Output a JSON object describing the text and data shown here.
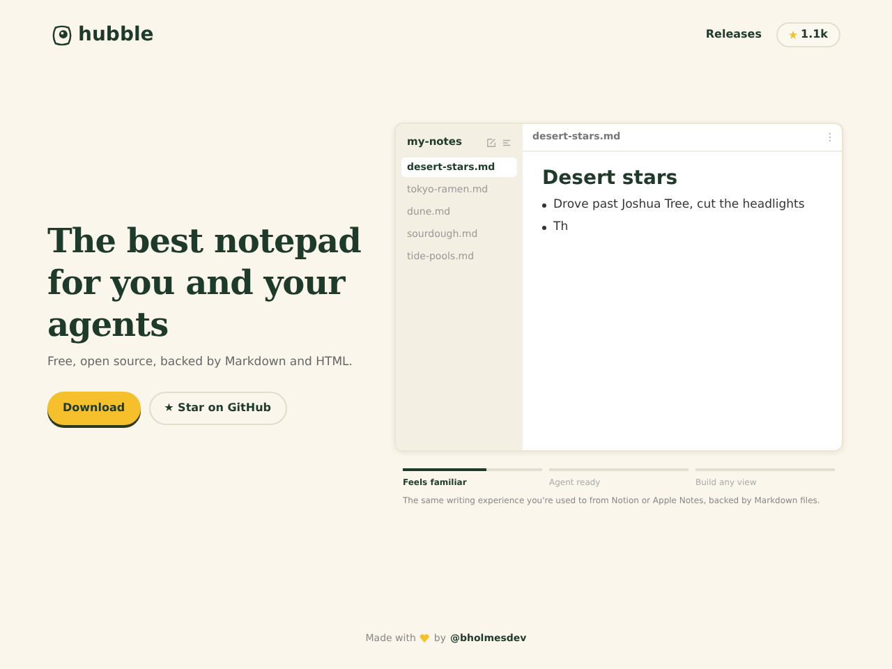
{
  "header": {
    "brand": "hubble",
    "releases": "Releases",
    "stars": "1.1k"
  },
  "hero": {
    "title": "The best notepad for you and your agents",
    "subtitle": "Free, open source, backed by Markdown and HTML.",
    "primary_button": "Download",
    "secondary_button": "★ Star on GitHub"
  },
  "app": {
    "folder": "my-notes",
    "files": [
      {
        "name": "desert-stars.md",
        "selected": true
      },
      {
        "name": "tokyo-ramen.md",
        "selected": false
      },
      {
        "name": "dune.md",
        "selected": false
      },
      {
        "name": "sourdough.md",
        "selected": false
      },
      {
        "name": "tide-pools.md",
        "selected": false
      }
    ],
    "tab_title": "desert-stars.md",
    "heading": "Desert stars",
    "bullets": [
      "Drove past Joshua Tree, cut the headlights",
      "Th"
    ]
  },
  "features": {
    "tabs": [
      {
        "label": "Feels familiar",
        "selected": true,
        "level": 0.6
      },
      {
        "label": "Agent ready",
        "selected": false
      },
      {
        "label": "Build any view",
        "selected": false
      }
    ],
    "description": "The same writing experience you're used to from Notion or Apple Notes, backed by Markdown files."
  },
  "footer": {
    "made_with": "Made with",
    "by": "by",
    "author": "@bholmesdev"
  }
}
